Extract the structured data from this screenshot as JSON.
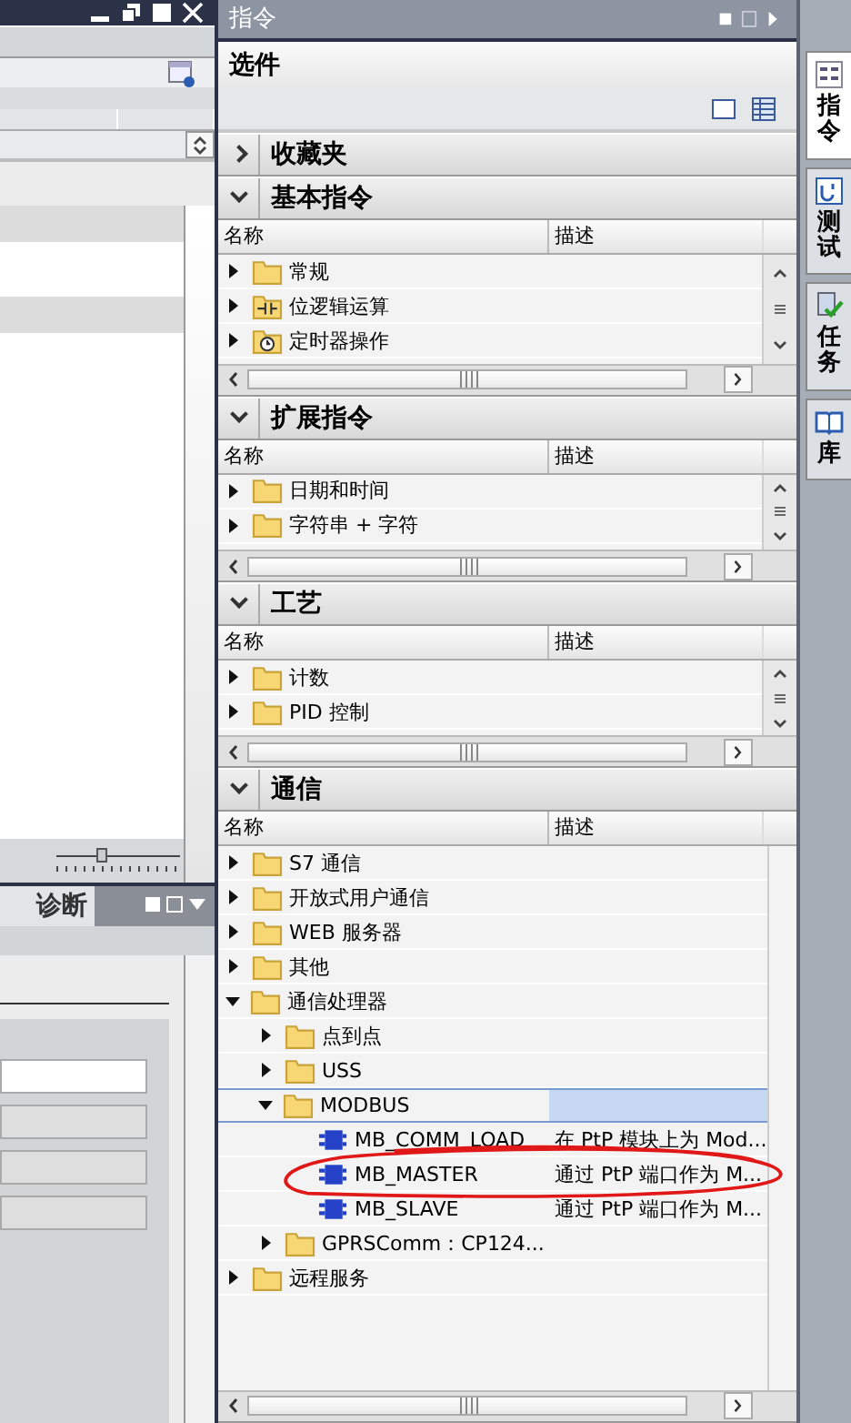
{
  "editor": {
    "zoom_slider": {
      "level": 0.37
    },
    "bottom_tab": {
      "label": "诊断"
    }
  },
  "task_card": {
    "title": "指令",
    "pane_title": "选件",
    "sections": [
      {
        "title": "收藏夹",
        "expanded": false
      },
      {
        "title": "基本指令",
        "expanded": true,
        "columns": [
          "名称",
          "描述"
        ],
        "rows": [
          {
            "name": "常规",
            "kind": "folder",
            "expanded": false,
            "selected": false
          },
          {
            "name": "位逻辑运算",
            "kind": "logic-folder",
            "expanded": false,
            "selected": false
          },
          {
            "name": "定时器操作",
            "kind": "timer-folder",
            "expanded": false,
            "selected": false
          }
        ]
      },
      {
        "title": "扩展指令",
        "expanded": true,
        "columns": [
          "名称",
          "描述"
        ],
        "rows": [
          {
            "name": "日期和时间",
            "kind": "folder",
            "expanded": false,
            "selected": false
          },
          {
            "name": "字符串 + 字符",
            "kind": "folder",
            "expanded": false,
            "selected": false
          }
        ]
      },
      {
        "title": "工艺",
        "expanded": true,
        "columns": [
          "名称",
          "描述"
        ],
        "rows": [
          {
            "name": "计数",
            "kind": "folder",
            "expanded": false,
            "selected": false
          },
          {
            "name": "PID 控制",
            "kind": "folder",
            "expanded": false,
            "selected": false
          }
        ]
      },
      {
        "title": "通信",
        "expanded": true,
        "columns": [
          "名称",
          "描述"
        ],
        "rows": [
          {
            "name": "S7 通信",
            "kind": "folder",
            "expanded": false,
            "selected": false
          },
          {
            "name": "开放式用户通信",
            "kind": "folder",
            "expanded": false,
            "selected": false
          },
          {
            "name": "WEB 服务器",
            "kind": "folder",
            "expanded": false,
            "selected": false
          },
          {
            "name": "其他",
            "kind": "folder",
            "expanded": false,
            "selected": false
          },
          {
            "name": "通信处理器",
            "kind": "folder",
            "expanded": true,
            "selected": false,
            "children": [
              {
                "name": "点到点",
                "kind": "folder",
                "expanded": false,
                "selected": false
              },
              {
                "name": "USS",
                "kind": "folder",
                "expanded": false,
                "selected": false
              },
              {
                "name": "MODBUS",
                "kind": "folder",
                "expanded": true,
                "selected": true,
                "children": [
                  {
                    "name": "MB_COMM_LOAD",
                    "kind": "block",
                    "selected": false,
                    "circled": false,
                    "description": "在 PtP 模块上为 Mod..."
                  },
                  {
                    "name": "MB_MASTER",
                    "kind": "block",
                    "selected": false,
                    "circled": true,
                    "description": "通过 PtP 端口作为 M..."
                  },
                  {
                    "name": "MB_SLAVE",
                    "kind": "block",
                    "selected": false,
                    "circled": false,
                    "description": "通过 PtP 端口作为 M..."
                  }
                ]
              },
              {
                "name": "GPRSComm：CP124...",
                "kind": "folder",
                "expanded": false,
                "selected": false
              }
            ]
          },
          {
            "name": "远程服务",
            "kind": "folder",
            "expanded": false,
            "selected": false
          }
        ]
      }
    ]
  },
  "side_tabs": [
    {
      "label": "指令",
      "kind": "instructions",
      "selected": true
    },
    {
      "label": "测试",
      "kind": "testing",
      "selected": false
    },
    {
      "label": "任务",
      "kind": "tasks",
      "selected": false
    },
    {
      "label": "库",
      "kind": "libraries",
      "selected": false
    }
  ]
}
